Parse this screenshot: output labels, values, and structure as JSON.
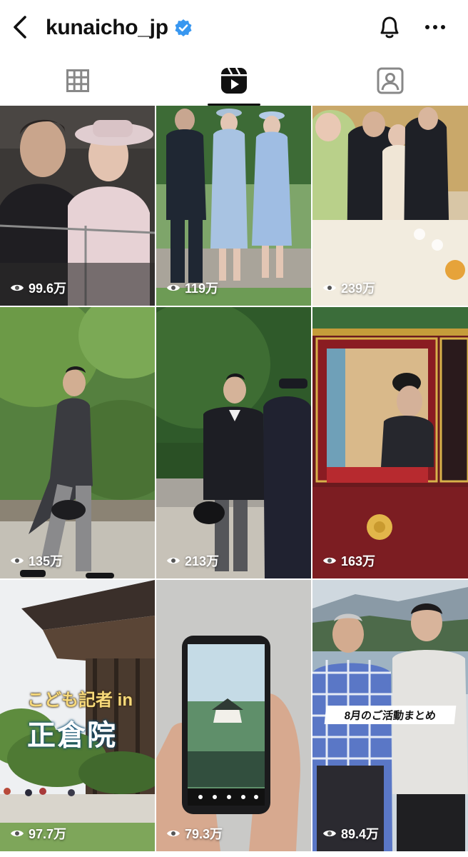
{
  "header": {
    "username": "kunaicho_jp",
    "verified": true,
    "back_icon": "chevron-left-icon",
    "bell_icon": "bell-icon",
    "more_icon": "more-horizontal-icon"
  },
  "tabs": [
    {
      "name": "posts-grid",
      "icon": "grid-icon",
      "active": false
    },
    {
      "name": "reels",
      "icon": "reels-icon",
      "active": true
    },
    {
      "name": "tagged",
      "icon": "tagged-person-icon",
      "active": false
    }
  ],
  "reels": [
    {
      "views": "99.6万"
    },
    {
      "views": "119万"
    },
    {
      "views": "239万"
    },
    {
      "views": "135万"
    },
    {
      "views": "213万"
    },
    {
      "views": "163万"
    },
    {
      "views": "97.7万",
      "overlay_small": "こども記者 in",
      "overlay_big": "正倉院"
    },
    {
      "views": "79.3万"
    },
    {
      "views": "89.4万",
      "caption": "8月のご活動まとめ"
    }
  ],
  "colors": {
    "verified": "#3897f0",
    "text": "#111111",
    "background": "#ffffff"
  }
}
